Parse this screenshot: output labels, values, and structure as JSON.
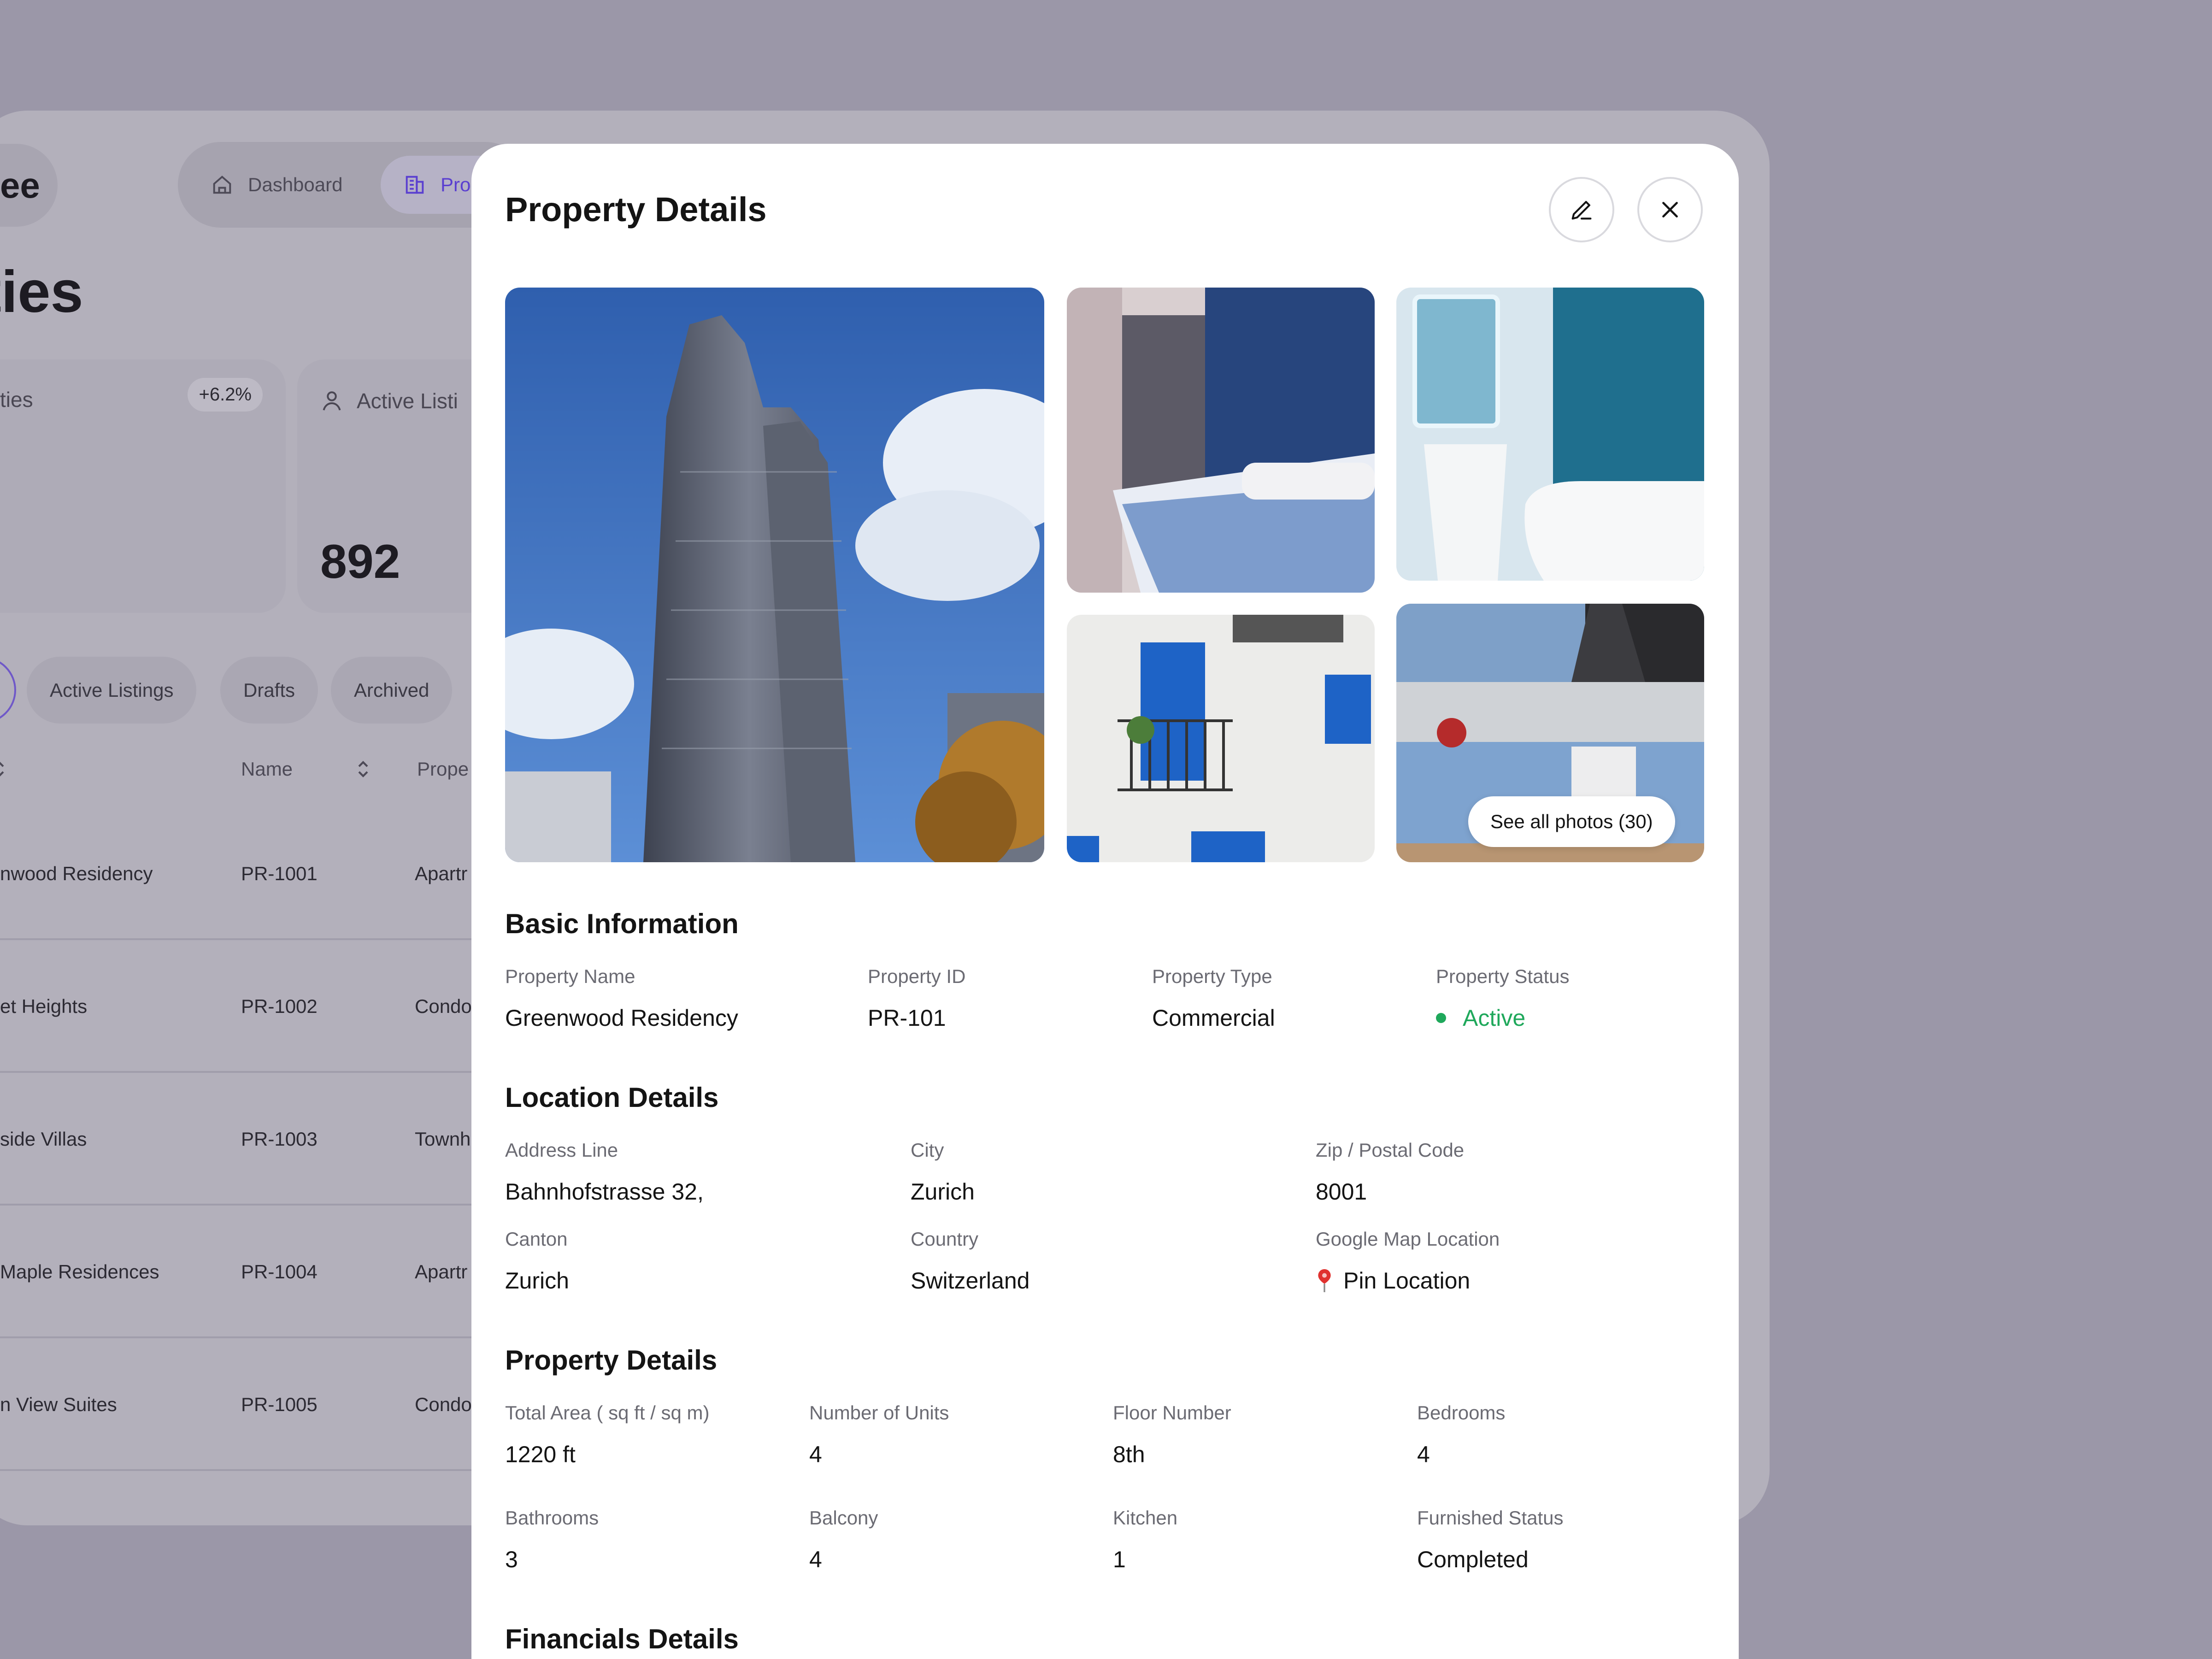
{
  "app": {
    "brand_fragment": "ee",
    "nav": {
      "dashboard": "Dashboard",
      "properties": "Pro"
    },
    "page_title_fragment": "ties",
    "stats": [
      {
        "label": "ties",
        "badge": "+6.2%"
      },
      {
        "label": "Active Listi",
        "value": "892"
      }
    ],
    "filters": [
      "Active Listings",
      "Drafts",
      "Archived"
    ],
    "table": {
      "headers": [
        "Name",
        "Prope"
      ],
      "rows": [
        {
          "name": "nwood Residency",
          "id": "PR-1001",
          "type": "Apartr"
        },
        {
          "name": "et Heights",
          "id": "PR-1002",
          "type": "Condo"
        },
        {
          "name": "side Villas",
          "id": "PR-1003",
          "type": "Townh"
        },
        {
          "name": "Maple Residences",
          "id": "PR-1004",
          "type": "Apartr"
        },
        {
          "name": "n View Suites",
          "id": "PR-1005",
          "type": "Condo"
        }
      ]
    }
  },
  "modal": {
    "title": "Property Details",
    "see_all_photos": "See all photos (30)",
    "basic": {
      "title": "Basic Information",
      "fields": [
        {
          "label": "Property Name",
          "value": "Greenwood Residency"
        },
        {
          "label": "Property ID",
          "value": "PR-101"
        },
        {
          "label": "Property Type",
          "value": "Commercial"
        },
        {
          "label": "Property Status",
          "value": "Active"
        }
      ]
    },
    "location": {
      "title": "Location Details",
      "fields": [
        {
          "label": "Address Line",
          "value": "Bahnhofstrasse 32,"
        },
        {
          "label": "City",
          "value": "Zurich"
        },
        {
          "label": "Zip / Postal Code",
          "value": "8001"
        },
        {
          "label": "Canton",
          "value": "Zurich"
        },
        {
          "label": "Country",
          "value": "Switzerland"
        },
        {
          "label": "Google Map Location",
          "value": "Pin Location"
        }
      ]
    },
    "details": {
      "title": "Property Details",
      "fields": [
        {
          "label": "Total Area ( sq ft / sq m)",
          "value": "1220 ft"
        },
        {
          "label": "Number of Units",
          "value": "4"
        },
        {
          "label": "Floor Number",
          "value": "8th"
        },
        {
          "label": "Bedrooms",
          "value": "4"
        },
        {
          "label": "Bathrooms",
          "value": "3"
        },
        {
          "label": "Balcony",
          "value": "4"
        },
        {
          "label": "Kitchen",
          "value": "1"
        },
        {
          "label": "Furnished Status",
          "value": "Completed"
        }
      ]
    },
    "financials": {
      "title": "Financials Details"
    }
  },
  "colors": {
    "status_active": "#1fa85b",
    "accent": "#5a3fd0",
    "backdrop": "#9b97a8"
  }
}
